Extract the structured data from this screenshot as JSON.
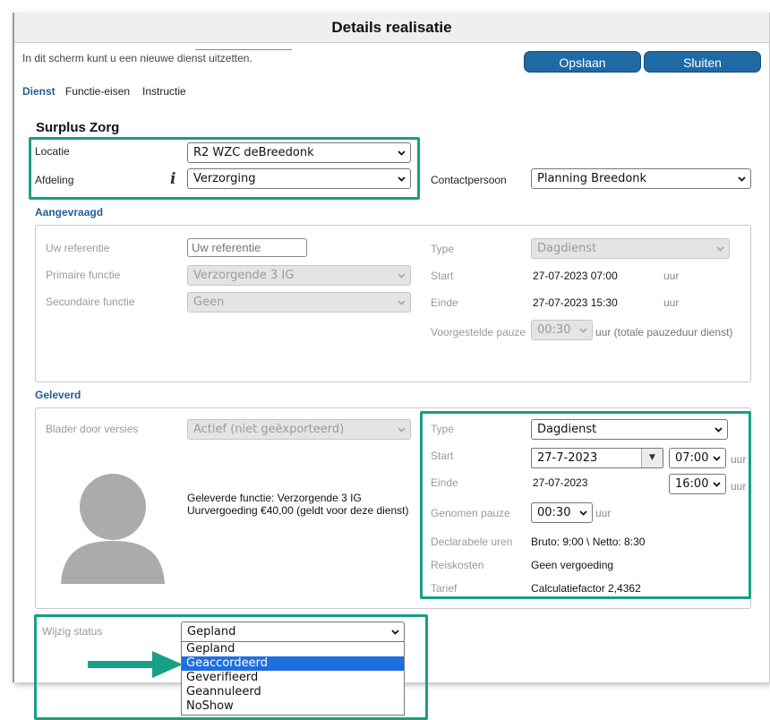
{
  "window": {
    "title": "Details realisatie"
  },
  "intro": "In dit scherm kunt u een nieuwe dienst uitzetten.",
  "actions": {
    "save": "Opslaan",
    "close": "Sluiten"
  },
  "tabs": [
    "Dienst",
    "Functie-eisen",
    "Instructie"
  ],
  "org_name": "Surplus Zorg",
  "location": {
    "label": "Locatie",
    "value": "R2 WZC deBreedonk"
  },
  "department": {
    "label": "Afdeling",
    "value": "Verzorging"
  },
  "contact": {
    "label": "Contactpersoon",
    "value": "Planning Breedonk"
  },
  "requested": {
    "title": "Aangevraagd",
    "reference": {
      "label": "Uw referentie",
      "placeholder": "Uw referentie"
    },
    "primary": {
      "label": "Primaire functie",
      "value": "Verzorgende 3 IG"
    },
    "secondary": {
      "label": "Secundaire functie",
      "value": "Geen"
    },
    "type": {
      "label": "Type",
      "value": "Dagdienst"
    },
    "start": {
      "label": "Start",
      "value": "27-07-2023 07:00",
      "unit": "uur"
    },
    "end": {
      "label": "Einde",
      "value": "27-07-2023 15:30",
      "unit": "uur"
    },
    "pause": {
      "label": "Voorgestelde pauze",
      "value": "00:30",
      "note": "uur (totale pauzeduur dienst)"
    }
  },
  "delivered": {
    "title": "Geleverd",
    "versions": {
      "label": "Blader door versies",
      "value": "Actief (niet geëxporteerd)"
    },
    "function_line": "Geleverde functie: Verzorgende 3 IG",
    "fee_line": "Uurvergoeding €40,00 (geldt voor deze dienst)",
    "type": {
      "label": "Type",
      "value": "Dagdienst"
    },
    "start": {
      "label": "Start",
      "date": "27-7-2023",
      "time": "07:00",
      "unit": "uur"
    },
    "end": {
      "label": "Einde",
      "date": "27-07-2023",
      "time": "16:00",
      "unit": "uur"
    },
    "pause": {
      "label": "Genomen pauze",
      "value": "00:30",
      "unit": "uur"
    },
    "declarable": {
      "label": "Declarabele uren",
      "value": "Bruto: 9:00 \\ Netto: 8:30"
    },
    "travel": {
      "label": "Reiskosten",
      "value": "Geen vergoeding"
    },
    "rate": {
      "label": "Tarief",
      "value": "Calculatiefactor 2,4362"
    }
  },
  "status": {
    "label": "Wijzig status",
    "value": "Gepland",
    "options": [
      "Gepland",
      "Geaccordeerd",
      "Geverifieerd",
      "Geannuleerd",
      "NoShow"
    ],
    "highlighted": 1
  },
  "colors": {
    "accent": "#1f6aa5",
    "highlight_box": "#16a085",
    "selection": "#1e6ee0"
  }
}
